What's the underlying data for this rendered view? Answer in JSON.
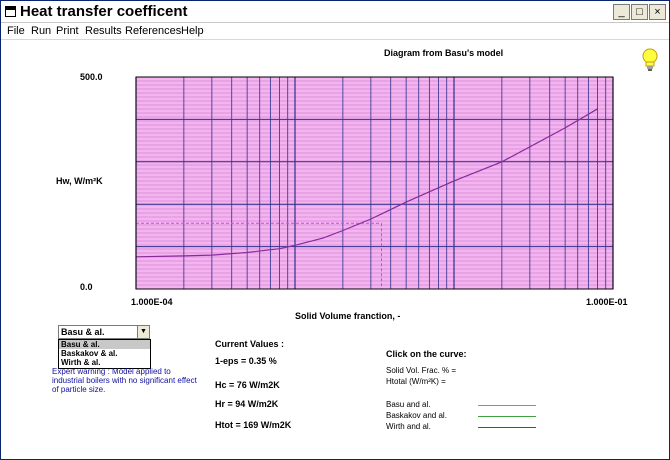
{
  "window": {
    "title": "Heat transfer coefficent",
    "controls": {
      "minimize": "_",
      "maximize": "□",
      "close": "×"
    }
  },
  "menu": [
    "File",
    "Run",
    "Print",
    "Results",
    "References",
    "Help"
  ],
  "chart_data": {
    "type": "line",
    "title": "Diagram from Basu's model",
    "ylabel": "Hw, W/m²K",
    "xlabel": "Solid Volume franction, -",
    "x_scale": "log",
    "xlim": [
      0.0001,
      0.1
    ],
    "ylim": [
      0,
      500
    ],
    "x_tick_labels": [
      "1.000E-04",
      "1.000E-01"
    ],
    "y_tick_labels": [
      "500.0",
      "0.0"
    ],
    "grid": true,
    "background_color": "#f4b4f0",
    "series": [
      {
        "color": "#8a2a9a",
        "x": [
          0.0001,
          0.0002,
          0.0003,
          0.0005,
          0.0008,
          0.001,
          0.0015,
          0.002,
          0.003,
          0.005,
          0.01,
          0.02,
          0.05,
          0.08
        ],
        "y": [
          76,
          78,
          80,
          86,
          95,
          103,
          120,
          138,
          165,
          205,
          255,
          300,
          380,
          425
        ]
      }
    ],
    "crosshair": {
      "x": 0.0035,
      "y": 155
    }
  },
  "model_select": {
    "selected": "Basu & al.",
    "options": [
      "Basu & al.",
      "Baskakov & al.",
      "Wirth & al."
    ]
  },
  "warning": "Expert warning : Model applied to industrial boilers with no significant effect of particle size.",
  "current_values": {
    "title": "Current Values :",
    "eps": "1-eps = 0.35 %",
    "hc": "Hc = 76 W/m2K",
    "hr": "Hr = 94 W/m2K",
    "htot": "Htot = 169 W/m2K"
  },
  "click_panel": {
    "title": "Click on the curve:",
    "solid_vol": "Solid Vol. Frac. % =",
    "htotal": "Htotal (W/m²K)   ="
  },
  "legend": [
    {
      "label": "Basu and al.",
      "color": "#ff40ff"
    },
    {
      "label": "Baskakov and al.",
      "color": "#40a040"
    },
    {
      "label": "Wirth and al.",
      "color": "#4040c0"
    }
  ]
}
